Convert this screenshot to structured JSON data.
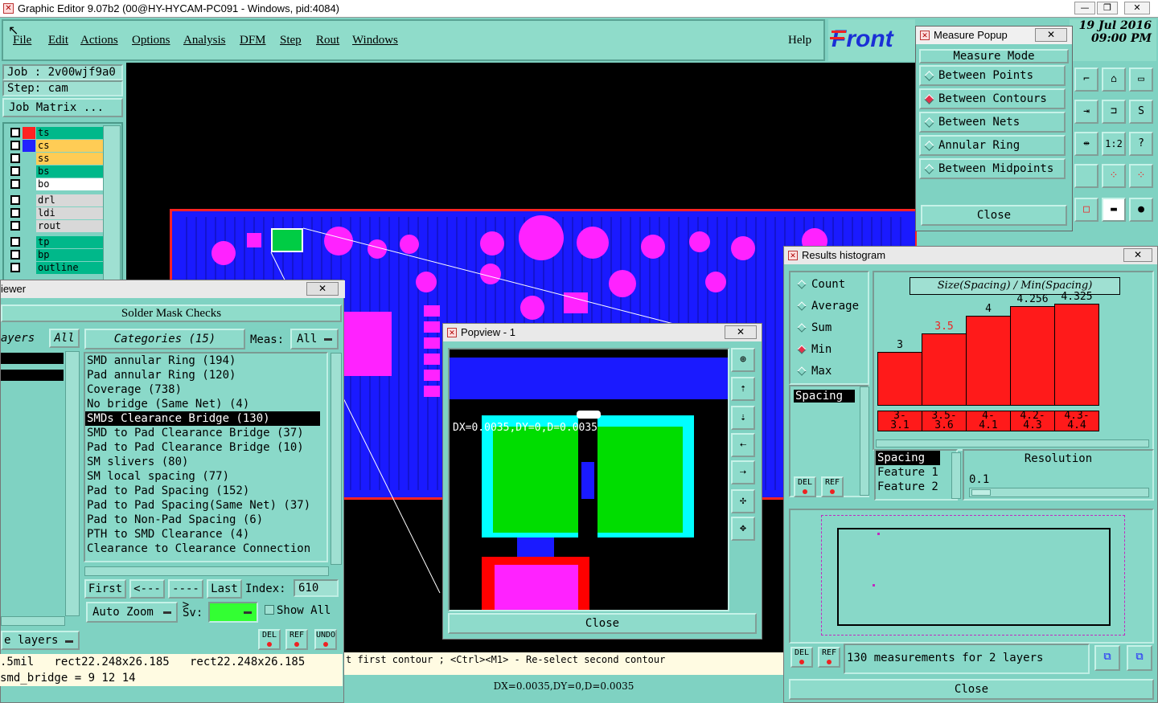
{
  "window": {
    "title": "Graphic Editor 9.07b2 (00@HY-HYCAM-PC091 - Windows, pid:4084)",
    "date": "19 Jul 2016",
    "time": "09:00 PM",
    "brand": "Front"
  },
  "menu": {
    "items": [
      "File",
      "Edit",
      "Actions",
      "Options",
      "Analysis",
      "DFM",
      "Step",
      "Rout",
      "Windows"
    ],
    "help": "Help"
  },
  "job": {
    "job_label": "Job : 2v00wjf9a0",
    "step_label": "Step: cam",
    "matrix_button": "Job Matrix ..."
  },
  "layers": [
    {
      "name": "ts",
      "color": "#00b88a",
      "swatch": "#ff2222"
    },
    {
      "name": "cs",
      "color": "#ffcc55",
      "swatch": "#2222ff"
    },
    {
      "name": "ss",
      "color": "#ffcc55",
      "swatch": ""
    },
    {
      "name": "bs",
      "color": "#00b88a",
      "swatch": ""
    },
    {
      "name": "bo",
      "color": "#ffffff",
      "swatch": ""
    },
    {
      "name": "drl",
      "color": "#d8d8d8",
      "swatch": ""
    },
    {
      "name": "ldi",
      "color": "#d8d8d8",
      "swatch": ""
    },
    {
      "name": "rout",
      "color": "#d8d8d8",
      "swatch": ""
    },
    {
      "name": "tp",
      "color": "#00b88a",
      "swatch": ""
    },
    {
      "name": "bp",
      "color": "#00b88a",
      "swatch": ""
    },
    {
      "name": "outline",
      "color": "#00b88a",
      "swatch": ""
    }
  ],
  "viewer": {
    "title_fragment": "iewer",
    "header": "Solder Mask Checks",
    "layers_label": "ayers",
    "all_label": "All",
    "categories_label": "Categories (15)",
    "meas_label": "Meas:",
    "meas_value": "All",
    "categories": [
      "SMD annular Ring (194)",
      "Pad annular Ring (120)",
      "Coverage (738)",
      "No bridge (Same Net) (4)",
      "SMDs Clearance Bridge (130)",
      "SMD to Pad Clearance Bridge (37)",
      "Pad to Pad Clearance Bridge (10)",
      "SM slivers (80)",
      "SM local spacing (77)",
      "Pad to Pad Spacing (152)",
      "Pad to Pad Spacing(Same Net) (37)",
      "Pad to Non-Pad Spacing (6)",
      "PTH to SMD Clearance (4)",
      "Clearance to Clearance Connection"
    ],
    "selected_index": 4,
    "nav": {
      "first": "First",
      "prev": "<----",
      "next": "---->",
      "last": "Last",
      "index_label": "Index:",
      "index_value": "610"
    },
    "auto_zoom": "Auto Zoom",
    "sv_label": "Sv:",
    "show_all": "Show All",
    "layers_btn": "e layers",
    "del": "DEL",
    "ref": "REF",
    "undo": "UNDO"
  },
  "status": {
    "line1": ".5mil   rect22.248x26.185   rect22.248x26.185",
    "line2": "smd_bridge = 9 12 14",
    "prompt": "t first contour ; <Ctrl><M1> - Re-select second contour",
    "coords": "DX=0.0035,DY=0,D=0.0035"
  },
  "measure_popup": {
    "title": "Measure Popup",
    "close_x": "✕",
    "header": "Measure Mode",
    "modes": [
      "Between Points",
      "Between Contours",
      "Between Nets",
      "Annular Ring",
      "Between Midpoints"
    ],
    "selected": 1,
    "close": "Close"
  },
  "popview": {
    "title": "Popview - 1",
    "measure_text": "DX=0.0035,DY=0,D=0.0035",
    "close": "Close"
  },
  "histogram": {
    "title": "Results histogram",
    "modes": [
      "Count",
      "Average",
      "Sum",
      "Min",
      "Max"
    ],
    "selected": 3,
    "spacing_list_item": "Spacing",
    "chart_title": "Size(Spacing) / Min(Spacing)",
    "bars": [
      {
        "label": "3",
        "range_top": "3-",
        "range_bot": "3.1",
        "value": 3,
        "highlight": false
      },
      {
        "label": "3.5",
        "range_top": "3.5-",
        "range_bot": "3.6",
        "value": 3.5,
        "highlight": true
      },
      {
        "label": "4",
        "range_top": "4-",
        "range_bot": "4.1",
        "value": 4,
        "highlight": false
      },
      {
        "label": "4.256",
        "range_top": "4.2-",
        "range_bot": "4.3",
        "value": 4.256,
        "highlight": false
      },
      {
        "label": "4.325",
        "range_top": "4.3-",
        "range_bot": "4.4",
        "value": 4.325,
        "highlight": false
      }
    ],
    "attributes": [
      "Spacing",
      "Feature 1",
      "Feature 2"
    ],
    "resolution_label": "Resolution",
    "resolution_value": "0.1",
    "summary": "130 measurements for 2 layers",
    "close": "Close",
    "del": "DEL",
    "ref": "REF"
  },
  "colors": {
    "copper_blue": "#1a1aff",
    "pad_magenta": "#ff22ff",
    "panel_teal": "#7fd2c2",
    "bar_red": "#ff1a1a"
  }
}
